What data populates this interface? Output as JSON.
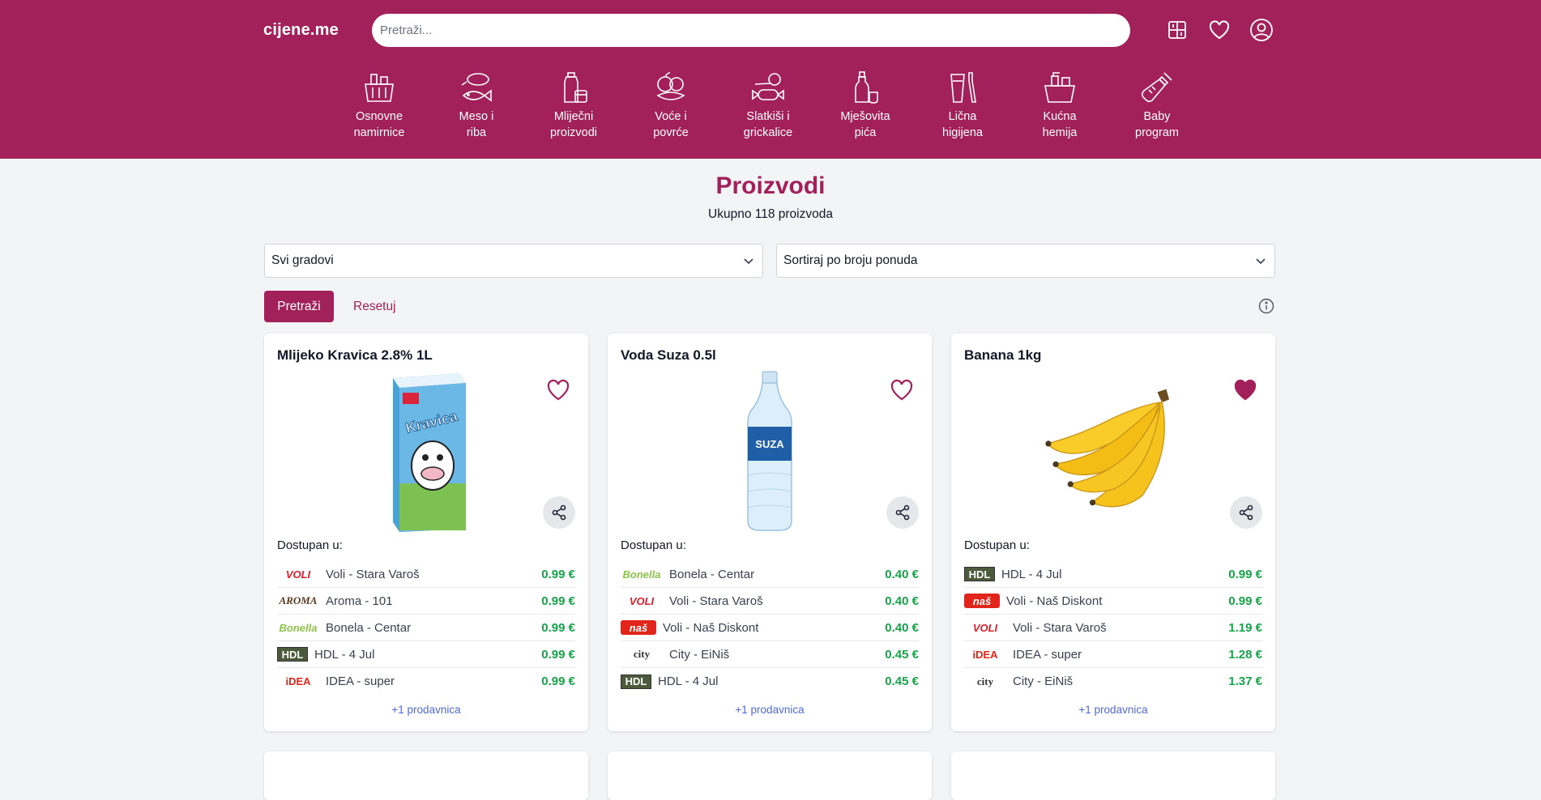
{
  "header": {
    "logo": "cijene.me",
    "search_placeholder": "Pretraži..."
  },
  "categories": [
    {
      "line1": "Osnovne",
      "line2": "namirnice",
      "icon": "basket-icon"
    },
    {
      "line1": "Meso i",
      "line2": "riba",
      "icon": "meat-fish-icon"
    },
    {
      "line1": "Mliječni",
      "line2": "proizvodi",
      "icon": "dairy-icon"
    },
    {
      "line1": "Voće i",
      "line2": "povrće",
      "icon": "fruit-vegetable-icon"
    },
    {
      "line1": "Slatkiši i",
      "line2": "grickalice",
      "icon": "sweets-icon"
    },
    {
      "line1": "Mješovita",
      "line2": "pića",
      "icon": "drinks-icon"
    },
    {
      "line1": "Lična",
      "line2": "higijena",
      "icon": "hygiene-icon"
    },
    {
      "line1": "Kućna",
      "line2": "hemija",
      "icon": "cleaning-icon"
    },
    {
      "line1": "Baby",
      "line2": "program",
      "icon": "baby-bottle-icon"
    }
  ],
  "main": {
    "title": "Proizvodi",
    "subtitle": "Ukupno 118 proizvoda",
    "city_select": "Svi gradovi",
    "sort_select": "Sortiraj po broju ponuda",
    "search_button": "Pretraži",
    "reset_button": "Resetuj"
  },
  "products": [
    {
      "name": "Mlijeko Kravica 2.8% 1L",
      "favorite": false,
      "available_label": "Dostupan u:",
      "stores": [
        {
          "logo": "VOLI",
          "name": "Voli - Stara Varoš",
          "price": "0.99 €"
        },
        {
          "logo": "AROMA",
          "name": "Aroma - 101",
          "price": "0.99 €"
        },
        {
          "logo": "Bonella",
          "name": "Bonela - Centar",
          "price": "0.99 €"
        },
        {
          "logo": "HDL",
          "name": "HDL - 4 Jul",
          "price": "0.99 €"
        },
        {
          "logo": "iDEA",
          "name": "IDEA - super",
          "price": "0.99 €"
        }
      ],
      "more": "+1 prodavnica"
    },
    {
      "name": "Voda Suza 0.5l",
      "favorite": false,
      "available_label": "Dostupan u:",
      "stores": [
        {
          "logo": "Bonella",
          "name": "Bonela - Centar",
          "price": "0.40 €"
        },
        {
          "logo": "VOLI",
          "name": "Voli - Stara Varoš",
          "price": "0.40 €"
        },
        {
          "logo": "naš",
          "name": "Voli - Naš Diskont",
          "price": "0.40 €"
        },
        {
          "logo": "city",
          "name": "City - EiNiš",
          "price": "0.45 €"
        },
        {
          "logo": "HDL",
          "name": "HDL - 4 Jul",
          "price": "0.45 €"
        }
      ],
      "more": "+1 prodavnica"
    },
    {
      "name": "Banana 1kg",
      "favorite": true,
      "available_label": "Dostupan u:",
      "stores": [
        {
          "logo": "HDL",
          "name": "HDL - 4 Jul",
          "price": "0.99 €"
        },
        {
          "logo": "naš",
          "name": "Voli - Naš Diskont",
          "price": "0.99 €"
        },
        {
          "logo": "VOLI",
          "name": "Voli - Stara Varoš",
          "price": "1.19 €"
        },
        {
          "logo": "iDEA",
          "name": "IDEA - super",
          "price": "1.28 €"
        },
        {
          "logo": "city",
          "name": "City - EiNiš",
          "price": "1.37 €"
        }
      ],
      "more": "+1 prodavnica"
    }
  ],
  "colors": {
    "brand": "#a3215a",
    "price": "#16a34a",
    "link": "#4f6bd6"
  }
}
